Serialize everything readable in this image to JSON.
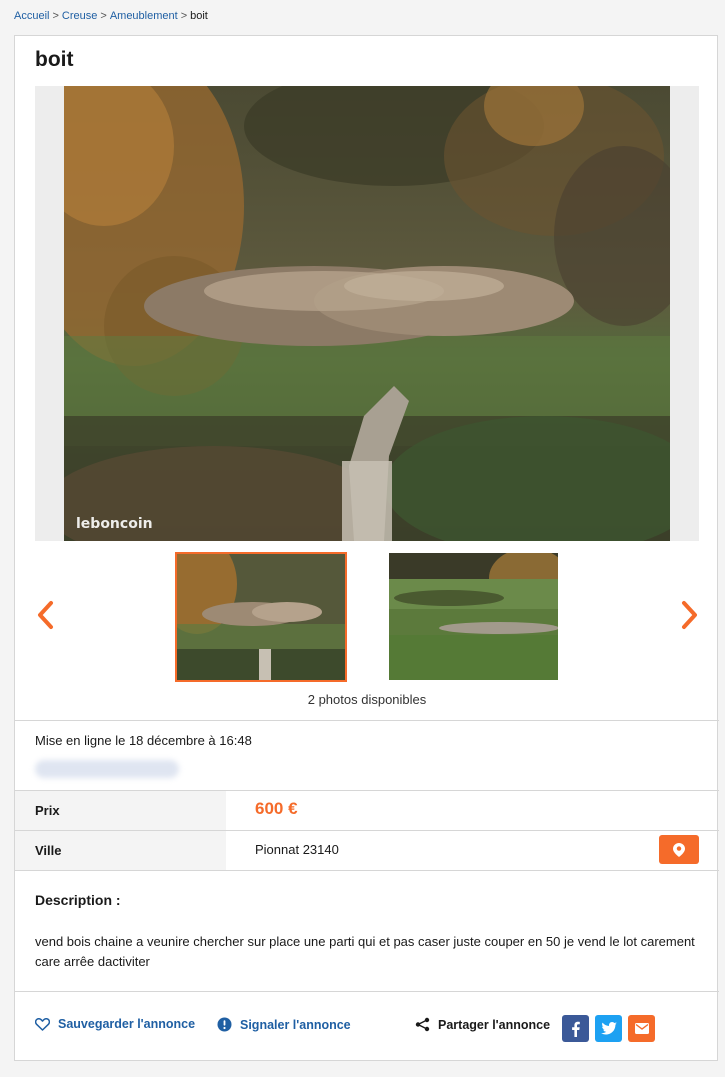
{
  "breadcrumb": {
    "items": [
      "Accueil",
      "Creuse",
      "Ameublement"
    ],
    "current": "boit",
    "separator": ">"
  },
  "ad": {
    "title": "boit",
    "watermark": "leboncoin",
    "photos_available": "2 photos disponibles",
    "posted": "Mise en ligne le 18 décembre à 16:48",
    "price_label": "Prix",
    "price": "600 €",
    "city_label": "Ville",
    "city": "Pionnat 23140",
    "description_title": "Description :",
    "description": "vend bois chaine a veunire chercher sur place une parti qui et pas caser juste couper en 50 je vend le lot carement care arrêe dactiviter"
  },
  "actions": {
    "save": "Sauvegarder l'annonce",
    "report": "Signaler l'annonce",
    "share": "Partager l'annonce"
  },
  "icons": {
    "prev": "chevron-left-icon",
    "next": "chevron-right-icon",
    "map": "map-pin-icon",
    "save": "heart-icon",
    "report": "alert-circle-icon",
    "share": "share-icon",
    "facebook": "facebook-icon",
    "twitter": "twitter-icon",
    "email": "email-icon"
  },
  "colors": {
    "accent": "#f56b2a",
    "link": "#1f5fa3",
    "facebook": "#3b5998",
    "twitter": "#1da1f2"
  }
}
